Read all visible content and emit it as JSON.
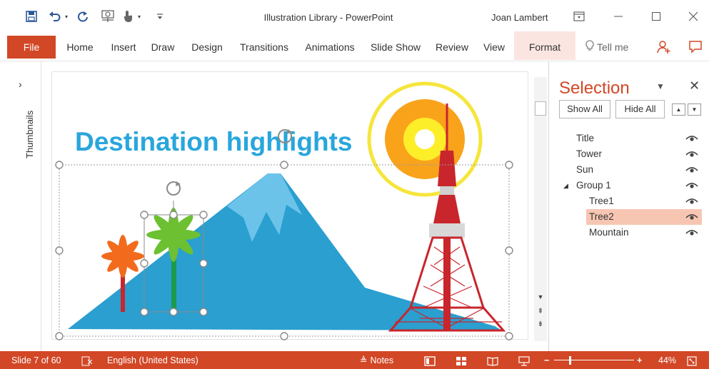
{
  "window": {
    "title": "Illustration Library - PowerPoint",
    "user": "Joan Lambert"
  },
  "quick_access": [
    "save-icon",
    "undo-icon",
    "redo-icon",
    "present-from-start-icon",
    "touch-mode-icon",
    "customize-qat-icon"
  ],
  "ribbon": {
    "tabs": [
      "File",
      "Home",
      "Insert",
      "Draw",
      "Design",
      "Transitions",
      "Animations",
      "Slide Show",
      "Review",
      "View",
      "Format"
    ],
    "active_tab": "Format",
    "tell_me": "Tell me"
  },
  "thumbnails": {
    "label": "Thumbnails",
    "expand": "›"
  },
  "slide": {
    "title": "Destination highlights"
  },
  "selection_pane": {
    "title": "Selection",
    "show_all": "Show All",
    "hide_all": "Hide All",
    "items": [
      {
        "label": "Title",
        "indent": 0,
        "selected": false,
        "visible": true
      },
      {
        "label": "Tower",
        "indent": 0,
        "selected": false,
        "visible": true
      },
      {
        "label": "Sun",
        "indent": 0,
        "selected": false,
        "visible": true
      },
      {
        "label": "Group 1",
        "indent": 0,
        "selected": false,
        "visible": true,
        "expanded": true
      },
      {
        "label": "Tree1",
        "indent": 1,
        "selected": false,
        "visible": true
      },
      {
        "label": "Tree2",
        "indent": 1,
        "selected": true,
        "visible": true
      },
      {
        "label": "Mountain",
        "indent": 1,
        "selected": false,
        "visible": true
      }
    ]
  },
  "statusbar": {
    "slide_counter": "Slide 7 of 60",
    "language": "English (United States)",
    "notes": "Notes",
    "zoom": "44%",
    "zoom_level": 0.44
  },
  "colors": {
    "accent": "#d24726",
    "title_text": "#29a6dc",
    "mountain": "#2a9fd0",
    "selection_highlight": "#f7c6b3",
    "tower": "#c8262c",
    "sun": "#f9a31b"
  }
}
